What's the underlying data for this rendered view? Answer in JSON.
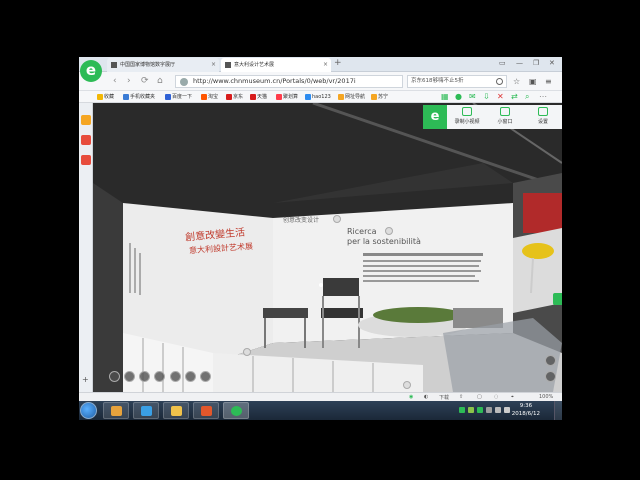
{
  "browser": {
    "logo": "e",
    "tabs": [
      {
        "label": "中国国家博物馆数字展厅"
      },
      {
        "label": "意大利设计艺术展"
      }
    ],
    "new_tab": "+",
    "window_controls": [
      "▭",
      "—",
      "❐",
      "✕"
    ],
    "address": {
      "url": "http://www.chnmuseum.cn/Portals/0/web/vr/2017i",
      "search": "京东618够嗨不止5折"
    },
    "nav": {
      "back": "‹",
      "forward": "›",
      "refresh": "⟳",
      "home": "⌂"
    },
    "bookmarks": [
      {
        "label": "收藏",
        "color": "#f2b705"
      },
      {
        "label": "手机收藏夹",
        "color": "#3a7bd5"
      },
      {
        "label": "百度一下",
        "color": "#2f62d6"
      },
      {
        "label": "淘宝",
        "color": "#ff5500"
      },
      {
        "label": "京东",
        "color": "#d71c1c"
      },
      {
        "label": "天猫",
        "color": "#d71c1c"
      },
      {
        "label": "聚划算",
        "color": "#ff3c4b"
      },
      {
        "label": "hao123",
        "color": "#2d8cf0"
      },
      {
        "label": "网址导航",
        "color": "#f5a623"
      },
      {
        "label": "苏宁",
        "color": "#f5a623"
      }
    ]
  },
  "floating_toolbar": {
    "logo": "e",
    "items": [
      {
        "label": "录制小视频"
      },
      {
        "label": "小窗口"
      },
      {
        "label": "设置"
      }
    ]
  },
  "scene": {
    "calligraphy_line1": "創意改變生活",
    "calligraphy_line2": "意大利設計艺术展",
    "sign_small": "创意改变设计",
    "panel_title1": "Ricerca",
    "panel_title2": "per la sostenibilità"
  },
  "status": {
    "download": "下载",
    "zoom": "100%"
  },
  "taskbar": {
    "time": "9:36",
    "date": "2018/6/12"
  }
}
